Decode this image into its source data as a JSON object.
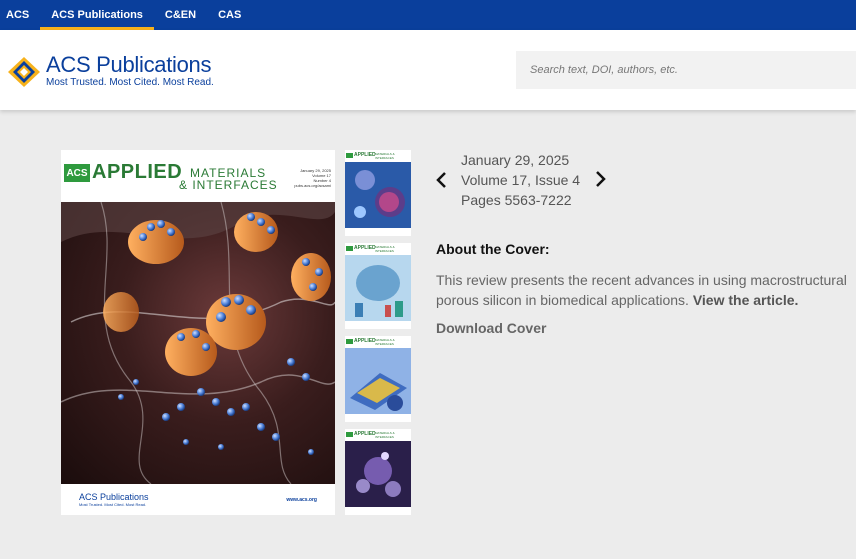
{
  "topnav": {
    "items": [
      {
        "label": "ACS",
        "active": false
      },
      {
        "label": "ACS Publications",
        "active": true
      },
      {
        "label": "C&EN",
        "active": false
      },
      {
        "label": "CAS",
        "active": false
      }
    ],
    "active_color": "#f7b21b",
    "background": "#0a3f9c"
  },
  "header": {
    "logo": {
      "name_prefix": "ACS",
      "name_suffix": "Publications",
      "tagline": "Most Trusted. Most Cited. Most Read."
    },
    "search": {
      "placeholder": "Search text, DOI, authors, etc."
    }
  },
  "cover": {
    "journal_acs": "ACS",
    "journal_applied": "APPLIED",
    "journal_materials": "MATERIALS",
    "journal_interfaces": "& INTERFACES",
    "meta_line1": "January 29, 2025",
    "meta_line2": "Volume 17",
    "meta_line3": "Number 4",
    "meta_line4": "pubs.acs.org/acsami",
    "foot_logo": "ACS Publications",
    "foot_tag": "Most Trusted. Most Cited. Most Read.",
    "foot_url": "www.acs.org"
  },
  "thumbnails": [
    {
      "title": "APPLIED",
      "subtitle": "MATERIALS & INTERFACES"
    },
    {
      "title": "APPLIED",
      "subtitle": "MATERIALS & INTERFACES"
    },
    {
      "title": "APPLIED",
      "subtitle": "MATERIALS & INTERFACES"
    },
    {
      "title": "APPLIED",
      "subtitle": "MATERIALS & INTERFACES"
    }
  ],
  "issue": {
    "date": "January 29, 2025",
    "volume": "Volume 17, Issue 4",
    "pages": "Pages 5563-7222",
    "prev_icon": "chevron-left-icon",
    "next_icon": "chevron-right-icon"
  },
  "about": {
    "title": "About the Cover:",
    "text": "This review presents the recent advances in using macrostructural porous silicon in biomedical applications.",
    "link": "View the article.",
    "download": "Download Cover"
  }
}
